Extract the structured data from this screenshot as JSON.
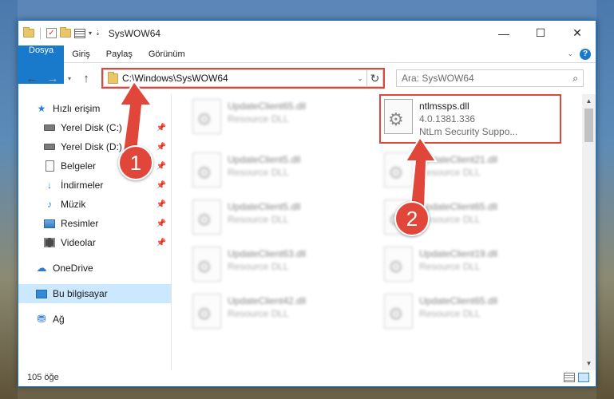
{
  "window": {
    "title": "SysWOW64",
    "controls": {
      "minimize": "—",
      "maximize": "☐",
      "close": "✕"
    }
  },
  "ribbon": {
    "tabs": [
      "Dosya",
      "Giriş",
      "Paylaş",
      "Görünüm"
    ]
  },
  "navbar": {
    "address": "C:\\Windows\\SysWOW64",
    "search_placeholder": "Ara: SysWOW64"
  },
  "sidebar": {
    "items": [
      {
        "label": "Hızlı erişim",
        "icon": "star-icon"
      },
      {
        "label": "Yerel Disk (C:)",
        "icon": "drive-icon",
        "pinned": true
      },
      {
        "label": "Yerel Disk (D:)",
        "icon": "drive-icon",
        "pinned": true
      },
      {
        "label": "Belgeler",
        "icon": "document-icon",
        "pinned": true
      },
      {
        "label": "İndirmeler",
        "icon": "download-icon",
        "pinned": true
      },
      {
        "label": "Müzik",
        "icon": "music-icon",
        "pinned": true
      },
      {
        "label": "Resimler",
        "icon": "pictures-icon",
        "pinned": true
      },
      {
        "label": "Videolar",
        "icon": "video-icon",
        "pinned": true
      },
      {
        "label": "OneDrive",
        "icon": "cloud-icon"
      },
      {
        "label": "Bu bilgisayar",
        "icon": "computer-icon",
        "selected": true
      },
      {
        "label": "Ağ",
        "icon": "network-icon"
      }
    ]
  },
  "files": [
    {
      "name": "UpdateClient65.dll",
      "meta": "Resource DLL",
      "blurred": true
    },
    {
      "name": "ntlmssps.dll",
      "meta": "4.0.1381.336",
      "meta2": "NtLm Security Suppo...",
      "blurred": false,
      "highlighted": true
    },
    {
      "name": "UpdateClient5.dll",
      "meta": "Resource DLL",
      "blurred": true
    },
    {
      "name": "UpdateClient21.dll",
      "meta": "Resource DLL",
      "blurred": true
    },
    {
      "name": "UpdateClient5.dll",
      "meta": "Resource DLL",
      "blurred": true
    },
    {
      "name": "UpdateClient65.dll",
      "meta": "Resource DLL",
      "blurred": true
    },
    {
      "name": "UpdateClient63.dll",
      "meta": "Resource DLL",
      "blurred": true
    },
    {
      "name": "UpdateClient19.dll",
      "meta": "Resource DLL",
      "blurred": true
    },
    {
      "name": "UpdateClient42.dll",
      "meta": "Resource DLL",
      "blurred": true
    },
    {
      "name": "UpdateClient65.dll",
      "meta": "Resource DLL",
      "blurred": true
    }
  ],
  "status": {
    "count": "105 öğe"
  },
  "annotations": {
    "step1": "1",
    "step2": "2",
    "color": "#e0463a"
  }
}
